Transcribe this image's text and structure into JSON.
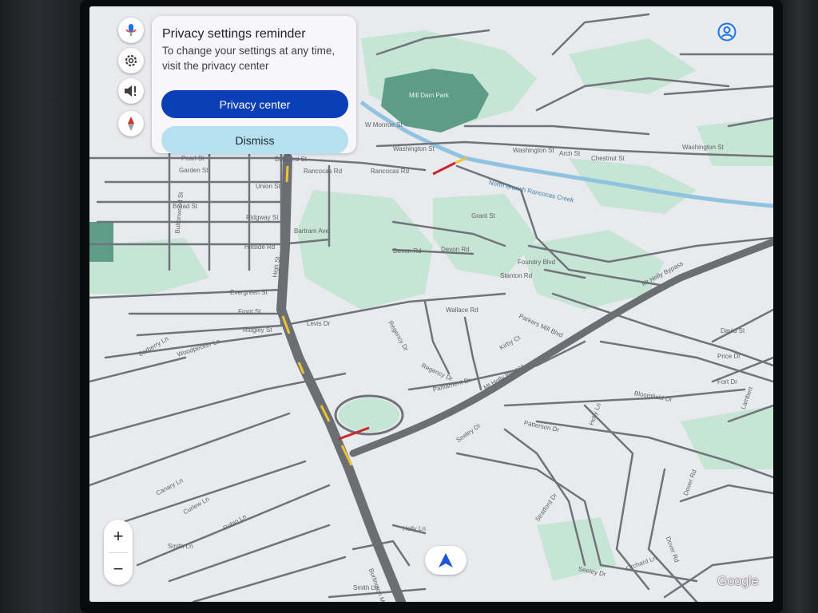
{
  "popup": {
    "title": "Privacy settings reminder",
    "body": "To change your settings at any time, visit the privacy center",
    "primary_label": "Privacy center",
    "secondary_label": "Dismiss"
  },
  "side_buttons": [
    {
      "name": "voice-search-button",
      "icon": "mic-icon"
    },
    {
      "name": "settings-button",
      "icon": "gear-icon"
    },
    {
      "name": "audio-alerts-button",
      "icon": "speaker-alert-icon"
    },
    {
      "name": "compass-button",
      "icon": "compass-icon"
    }
  ],
  "zoom": {
    "in_label": "+",
    "out_label": "−"
  },
  "brand": "Google",
  "colors": {
    "map_background": "#e9eaee",
    "park": "#c7e5d4",
    "lake": "#5d9c87",
    "creek": "#8fc3e0",
    "road": "#6f747a",
    "highway": "#6b6f74",
    "traffic_slow": "#f1c232",
    "traffic_heavy": "#c62828",
    "primary_button": "#0b3fb8",
    "secondary_button": "#b6e0f0",
    "nav_arrow": "#1a56db"
  },
  "map": {
    "park_name": "Mill Dam Park",
    "roads": [
      "Pearl St",
      "Garden St",
      "Union St",
      "Broad St",
      "Ridgway St",
      "Hillside Rd",
      "Bartram Ave",
      "Evergreen St",
      "Front St",
      "Ridgley St",
      "Levis Dr",
      "Barberry Ln",
      "Woodpecker Ln",
      "High St",
      "Rancocas Rd",
      "Washington St",
      "W Monroe St",
      "Brainerd St",
      "Arch St",
      "Chestnut St",
      "Grant St",
      "Devon Rd",
      "Foundry Blvd",
      "Stanton Rd",
      "Wallace Rd",
      "Regency Dr",
      "Parliament Dr",
      "Kirby Ct",
      "Parkers Mill Blvd",
      "Mt Holly Bypass",
      "David St",
      "Price Dr",
      "Fort Dr",
      "Bloomfield Dr",
      "Patterson Dr",
      "Seeley Dr",
      "Holly Ln",
      "Canary Ln",
      "Curlew Ln",
      "Robin Ln",
      "Smith Ln",
      "Burlington Mount Holly Rd",
      "Stratford Dr",
      "Orchard Ln",
      "Dover Rd",
      "Lambert",
      "Buttonwood St"
    ],
    "waterway": "North Branch Rancocas Creek"
  }
}
